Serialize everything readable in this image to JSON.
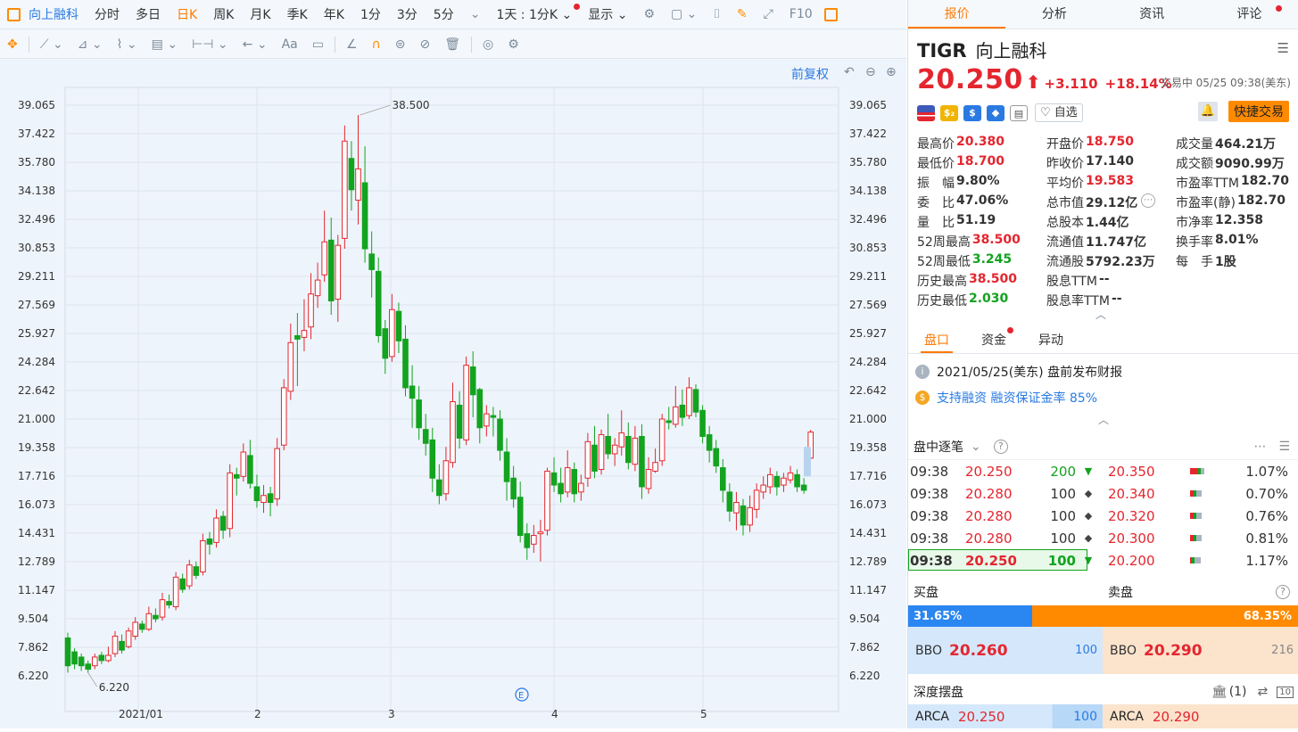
{
  "toolbar": {
    "name": "向上融科",
    "periods": [
      "分时",
      "多日",
      "日K",
      "周K",
      "月K",
      "季K",
      "年K",
      "1分",
      "3分",
      "5分"
    ],
    "selected_period": "日K",
    "range": "1天 : 1分K",
    "display": "显示",
    "f10": "F10"
  },
  "chart": {
    "adjust": "前复权",
    "price_ticks": [
      "39.065",
      "37.422",
      "35.780",
      "34.138",
      "32.496",
      "30.853",
      "29.211",
      "27.569",
      "25.927",
      "24.284",
      "22.642",
      "21.000",
      "19.358",
      "17.716",
      "16.073",
      "14.431",
      "12.789",
      "11.147",
      "9.504",
      "7.862",
      "6.220"
    ],
    "date_ticks": [
      "2021/01",
      "2",
      "3",
      "4",
      "5"
    ],
    "high_label": "38.500",
    "low_label": "6.220",
    "event_marker": "E"
  },
  "chart_data": {
    "type": "candlestick",
    "ylim": [
      6.22,
      39.065
    ],
    "last_price": 20.25,
    "annotations": {
      "max": 38.5,
      "min": 6.22
    }
  },
  "tabs": [
    "报价",
    "分析",
    "资讯",
    "评论"
  ],
  "active_tab": "报价",
  "quote": {
    "symbol": "TIGR",
    "name": "向上融科",
    "price": "20.250",
    "change": "+3.110",
    "change_pct": "+18.14%",
    "status": "交易中 05/25 09:38(美东)",
    "watch": "自选",
    "quick_trade": "快捷交易"
  },
  "stats": [
    [
      {
        "l": "最高价",
        "v": "20.380",
        "c": "red"
      },
      {
        "l": "开盘价",
        "v": "18.750",
        "c": "red"
      },
      {
        "l": "成交量",
        "v": "464.21万",
        "c": ""
      }
    ],
    [
      {
        "l": "最低价",
        "v": "18.700",
        "c": "red"
      },
      {
        "l": "昨收价",
        "v": "17.140",
        "c": ""
      },
      {
        "l": "成交额",
        "v": "9090.99万",
        "c": ""
      }
    ],
    [
      {
        "l": "振　幅",
        "v": "9.80%",
        "c": ""
      },
      {
        "l": "平均价",
        "v": "19.583",
        "c": "red"
      },
      {
        "l": "市盈率TTM",
        "v": "182.70",
        "c": ""
      }
    ],
    [
      {
        "l": "委　比",
        "v": "47.06%",
        "c": ""
      },
      {
        "l": "总市值",
        "v": "29.12亿",
        "c": ""
      },
      {
        "l": "市盈率(静)",
        "v": "182.70",
        "c": ""
      }
    ],
    [
      {
        "l": "量　比",
        "v": "51.19",
        "c": ""
      },
      {
        "l": "总股本",
        "v": "1.44亿",
        "c": ""
      },
      {
        "l": "市净率",
        "v": "12.358",
        "c": ""
      }
    ],
    [
      {
        "l": "52周最高",
        "v": "38.500",
        "c": "red"
      },
      {
        "l": "流通值",
        "v": "11.747亿",
        "c": ""
      },
      {
        "l": "换手率",
        "v": "8.01%",
        "c": ""
      }
    ],
    [
      {
        "l": "52周最低",
        "v": "3.245",
        "c": "grn"
      },
      {
        "l": "流通股",
        "v": "5792.23万",
        "c": ""
      },
      {
        "l": "每　手",
        "v": "1股",
        "c": ""
      }
    ],
    [
      {
        "l": "历史最高",
        "v": "38.500",
        "c": "red"
      },
      {
        "l": "股息TTM",
        "v": "--",
        "c": ""
      },
      {
        "l": "",
        "v": "",
        "c": ""
      }
    ],
    [
      {
        "l": "历史最低",
        "v": "2.030",
        "c": "grn"
      },
      {
        "l": "股息率TTM",
        "v": "--",
        "c": ""
      },
      {
        "l": "",
        "v": "",
        "c": ""
      }
    ]
  ],
  "subtabs": [
    "盘口",
    "资金",
    "异动"
  ],
  "news": [
    {
      "icon": "i",
      "text": "2021/05/25(美东)  盘前发布财报"
    },
    {
      "icon": "$",
      "text": "支持融资 融资保证金率 85%"
    }
  ],
  "ticks": {
    "title": "盘中逐笔",
    "rows": [
      {
        "t": "09:38",
        "p": "20.250",
        "v": "200",
        "m": "▼",
        "p2": "20.350",
        "pct": "1.07%",
        "r": 0.5
      },
      {
        "t": "09:38",
        "p": "20.280",
        "v": "100",
        "m": "◆",
        "p2": "20.340",
        "pct": "0.70%",
        "r": 0.2
      },
      {
        "t": "09:38",
        "p": "20.280",
        "v": "100",
        "m": "◆",
        "p2": "20.320",
        "pct": "0.76%",
        "r": 0.2
      },
      {
        "t": "09:38",
        "p": "20.280",
        "v": "100",
        "m": "◆",
        "p2": "20.300",
        "pct": "0.81%",
        "r": 0.2
      },
      {
        "t": "09:38",
        "p": "20.250",
        "v": "100",
        "m": "▼",
        "p2": "20.200",
        "pct": "1.17%",
        "r": 0.1
      }
    ]
  },
  "book": {
    "buy_label": "买盘",
    "sell_label": "卖盘",
    "buy_pct": "31.65%",
    "sell_pct": "68.35%",
    "buy_ratio": 0.3165,
    "bid_ex": "BBO",
    "bid": "20.260",
    "bid_size": "100",
    "ask_ex": "BBO",
    "ask": "20.290",
    "ask_size": "216"
  },
  "depth": {
    "title": "深度摆盘",
    "count": "(1)",
    "bid_ex": "ARCA",
    "bid": "20.250",
    "bid_size": "100",
    "ask_ex": "ARCA",
    "ask": "20.290"
  }
}
